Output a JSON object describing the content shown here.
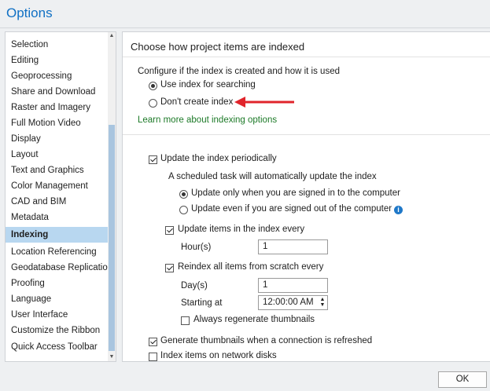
{
  "window": {
    "title": "Options"
  },
  "sidebar": {
    "items": [
      {
        "label": "Selection"
      },
      {
        "label": "Editing"
      },
      {
        "label": "Geoprocessing"
      },
      {
        "label": "Share and Download"
      },
      {
        "label": "Raster and Imagery"
      },
      {
        "label": "Full Motion Video"
      },
      {
        "label": "Display"
      },
      {
        "label": "Layout"
      },
      {
        "label": "Text and Graphics"
      },
      {
        "label": "Color Management"
      },
      {
        "label": "CAD and BIM"
      },
      {
        "label": "Metadata"
      },
      {
        "label": "Indexing"
      },
      {
        "label": "Location Referencing"
      },
      {
        "label": "Geodatabase Replication"
      },
      {
        "label": "Proofing"
      },
      {
        "label": "Language"
      },
      {
        "label": "User Interface"
      },
      {
        "label": "Customize the Ribbon"
      },
      {
        "label": "Quick Access Toolbar"
      }
    ],
    "active_item": "Indexing"
  },
  "indexing": {
    "heading": "Choose how project items are indexed",
    "configure_label": "Configure if the index is created and how it is used",
    "use_index": "Use index for searching",
    "dont_create": "Don't create index",
    "learn_more": "Learn more about indexing options",
    "update_periodically": "Update the index periodically",
    "scheduled_task_note": "A scheduled task will automatically update the index",
    "signed_in_only": "Update only when you are signed in to the computer",
    "signed_out_too": "Update even if you are signed out of the computer",
    "update_items_every": "Update items in the index every",
    "hours_label": "Hour(s)",
    "hours_value": "1",
    "reindex_all": "Reindex all items from scratch every",
    "days_label": "Day(s)",
    "days_value": "1",
    "starting_at_label": "Starting at",
    "starting_at_value": "12:00:00 AM",
    "always_regenerate": "Always regenerate thumbnails",
    "generate_thumbnails": "Generate thumbnails when a connection is refreshed",
    "network_disks": "Index items on network disks"
  },
  "footer": {
    "ok_label": "OK"
  },
  "colors": {
    "title": "#1070c4",
    "link": "#1d7a28",
    "active_bg": "#b8d7f0",
    "arrow": "#e0242b"
  }
}
